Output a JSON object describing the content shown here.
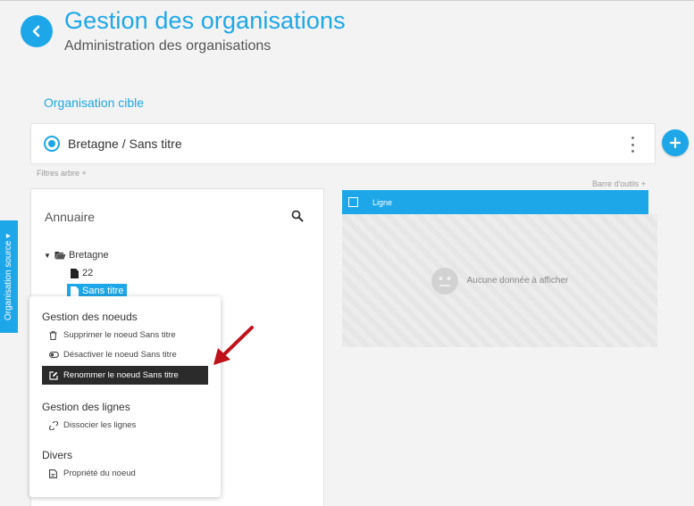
{
  "header": {
    "title": "Gestion des organisations",
    "subtitle": "Administration des organisations"
  },
  "target": {
    "section_label": "Organisation cible",
    "org_path": "Bretagne / Sans titre"
  },
  "filters_label": "Filtres arbre +",
  "toolbar_label": "Barre d'outils +",
  "side_tab_label": "Organisation source ▾",
  "directory": {
    "title": "Annuaire",
    "tree": [
      {
        "label": "Bretagne",
        "expanded": true
      },
      {
        "label": "22"
      },
      {
        "label": "Sans titre",
        "selected": true
      }
    ]
  },
  "grid": {
    "columns": [
      "Ligne"
    ],
    "empty_message": "Aucune donnée à afficher"
  },
  "context_menu": {
    "group1": {
      "title": "Gestion des noeuds",
      "items": [
        {
          "label": "Supprimer le noeud Sans titre",
          "icon": "trash-icon"
        },
        {
          "label": "Désactiver le noeud Sans titre",
          "icon": "toggle-icon"
        },
        {
          "label": "Renommer le noeud Sans titre",
          "icon": "edit-icon",
          "active": true
        }
      ]
    },
    "group2": {
      "title": "Gestion des lignes",
      "items": [
        {
          "label": "Dissocier les lignes",
          "icon": "unlink-icon"
        }
      ]
    },
    "group3": {
      "title": "Divers",
      "items": [
        {
          "label": "Propriété du noeud",
          "icon": "properties-icon"
        }
      ]
    }
  },
  "colors": {
    "accent": "#1ea7e8",
    "annotation_arrow": "#c0111a",
    "active_menu_bg": "#2b2b2b"
  }
}
